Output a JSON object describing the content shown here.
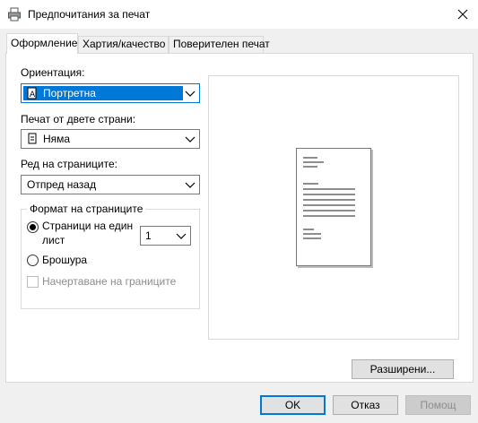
{
  "window": {
    "title": "Предпочитания за печат",
    "icon": "printer-icon",
    "close_icon": "close-icon"
  },
  "tabs": [
    {
      "label": "Оформление",
      "active": true
    },
    {
      "label": "Хартия/качество",
      "active": false
    },
    {
      "label": "Поверителен печат",
      "active": false
    }
  ],
  "layout": {
    "orientation_label": "Ориентация:",
    "orientation_value": "Портретна",
    "duplex_label": "Печат от двете страни:",
    "duplex_value": "Няма",
    "page_order_label": "Ред на страниците:",
    "page_order_value": "Отпред назад",
    "page_format": {
      "group_label": "Формат на страниците",
      "pages_per_sheet_label_line1": "Страници на един",
      "pages_per_sheet_label_line2": "лист",
      "pages_per_sheet_value": "1",
      "pages_per_sheet_checked": true,
      "booklet_label": "Брошура",
      "booklet_checked": false,
      "draw_borders_label": "Начертаване на границите",
      "draw_borders_checked": false,
      "draw_borders_disabled": true
    }
  },
  "buttons": {
    "advanced": "Разширени...",
    "ok": "OK",
    "cancel": "Отказ",
    "help": "Помощ"
  },
  "colors": {
    "accent": "#0078d7",
    "dialog_bg": "#f0f0f0",
    "disabled_text": "#8d8d8d"
  }
}
